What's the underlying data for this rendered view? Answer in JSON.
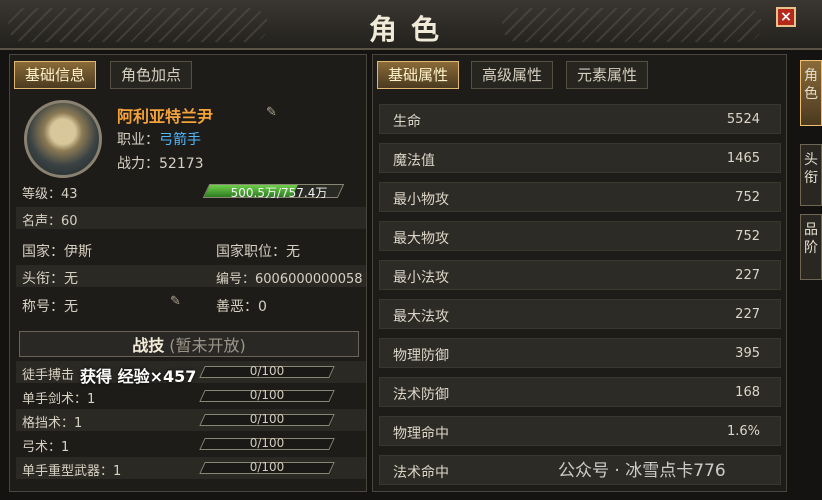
{
  "window": {
    "title": "角色",
    "close": "×"
  },
  "left_tabs": [
    "基础信息",
    "角色加点"
  ],
  "player": {
    "name": "阿利亚特兰尹",
    "job_label": "职业：",
    "job": "弓箭手",
    "power": "战力：52173",
    "level": "等级：43",
    "exp_text": "500.5万/757.4万",
    "exp_fraction": 0.661,
    "fame": "名声：60",
    "country": "国家：伊斯",
    "country_post": "国家职位：无",
    "headtitle": "头衔：无",
    "number": "编号：6006000000058",
    "nickname": "称号：无",
    "morality": "善恶：0"
  },
  "combat_skill": {
    "title": "战技",
    "subtitle": "(暂未开放)"
  },
  "toast": "获得 经验×457",
  "skills": [
    {
      "name": "徒手搏击",
      "value": "0/100"
    },
    {
      "name": "单手剑术：1",
      "value": "0/100"
    },
    {
      "name": "格挡术：1",
      "value": "0/100"
    },
    {
      "name": "弓术：1",
      "value": "0/100"
    },
    {
      "name": "单手重型武器：1",
      "value": "0/100"
    }
  ],
  "right_tabs": [
    "基础属性",
    "高级属性",
    "元素属性"
  ],
  "attributes": [
    {
      "k": "生命",
      "v": "5524"
    },
    {
      "k": "魔法值",
      "v": "1465"
    },
    {
      "k": "最小物攻",
      "v": "752"
    },
    {
      "k": "最大物攻",
      "v": "752"
    },
    {
      "k": "最小法攻",
      "v": "227"
    },
    {
      "k": "最大法攻",
      "v": "227"
    },
    {
      "k": "物理防御",
      "v": "395"
    },
    {
      "k": "法术防御",
      "v": "168"
    },
    {
      "k": "物理命中",
      "v": "1.6%"
    },
    {
      "k": "法术命中",
      "v": ""
    }
  ],
  "side_tabs": [
    "角色",
    "头衔",
    "品阶"
  ],
  "watermark": "公众号 · 冰雪点卡776",
  "icons": {
    "close": "close-icon",
    "edit": "quill-icon",
    "avatar": "portrait"
  },
  "colors": {
    "accent": "#f4a23a",
    "job": "#4fb8ff",
    "exp": "#4caf32",
    "close": "#b5281c"
  }
}
